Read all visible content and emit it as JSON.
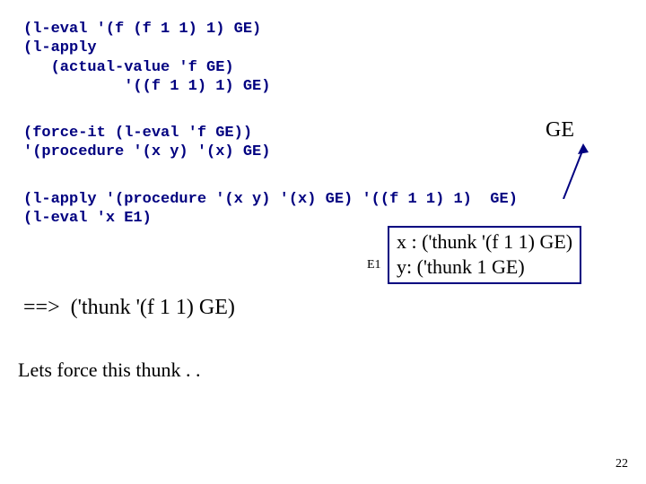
{
  "block1": "(l-eval '(f (f 1 1) 1) GE)\n(l-apply\n   (actual-value 'f GE)\n           '((f 1 1) 1) GE)",
  "block2": "(force-it (l-eval 'f GE))\n'(procedure '(x y) '(x) GE)",
  "block3": "(l-apply '(procedure '(x y) '(x) GE) '((f 1 1) 1)  GE)\n(l-eval 'x E1)",
  "ge_label": "GE",
  "env": {
    "line1": "x : ('thunk '(f 1 1) GE)",
    "line2": "y: ('thunk 1 GE)"
  },
  "e1_label": "E1",
  "result_arrow": "==>",
  "result_text": "('thunk '(f 1 1) GE)",
  "force_text": "Lets force this thunk . .",
  "page_number": "22"
}
